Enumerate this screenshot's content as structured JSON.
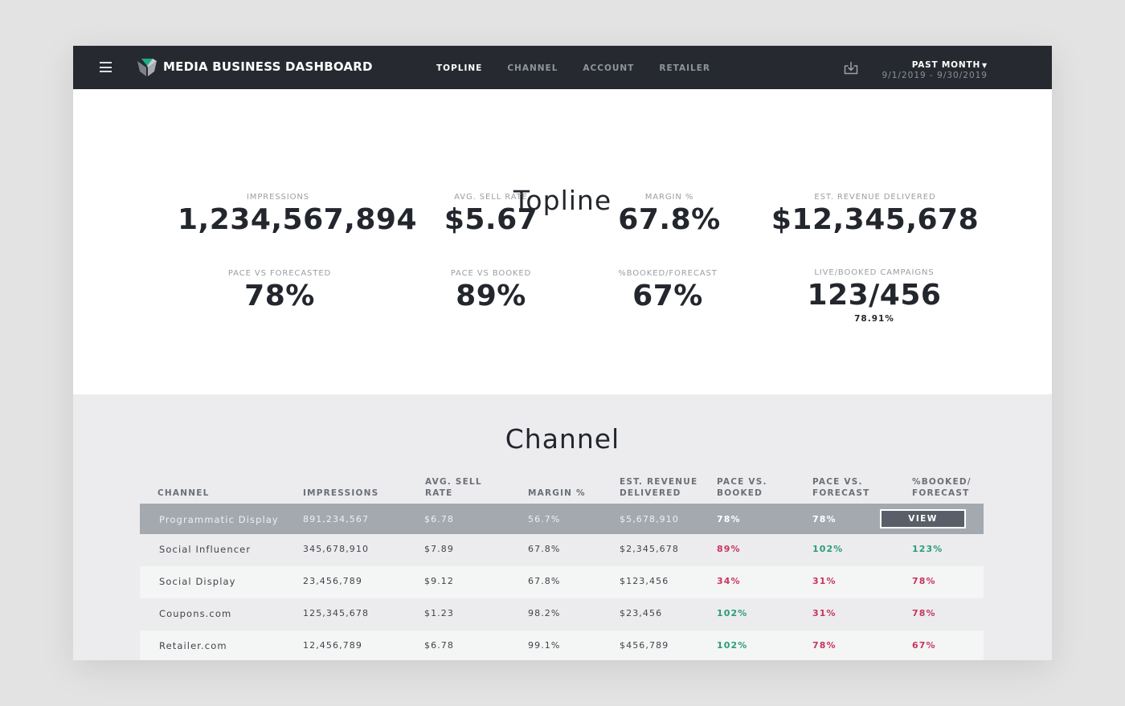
{
  "header": {
    "menu_icon": "hamburger-menu-icon",
    "logo_icon": "brand-logo-icon",
    "app_title": "MEDIA BUSINESS DASHBOARD",
    "nav": [
      {
        "label": "TOPLINE",
        "active": true
      },
      {
        "label": "CHANNEL",
        "active": false
      },
      {
        "label": "ACCOUNT",
        "active": false
      },
      {
        "label": "RETAILER",
        "active": false
      }
    ],
    "download_icon": "download-icon",
    "period": {
      "label": "PAST MONTH",
      "chevron": "⌄",
      "range": "9/1/2019 - 9/30/2019"
    }
  },
  "topline": {
    "title": "Topline",
    "kpis": [
      {
        "label": "IMPRESSIONS",
        "value": "1,234,567,894"
      },
      {
        "label": "AVG. SELL RATE",
        "value": "$5.67"
      },
      {
        "label": "MARGIN %",
        "value": "67.8%"
      },
      {
        "label": "EST. REVENUE DELIVERED",
        "value": "$12,345,678"
      },
      {
        "label": "PACE VS FORECASTED",
        "value": "78%"
      },
      {
        "label": "PACE VS BOOKED",
        "value": "89%"
      },
      {
        "label": "%BOOKED/FORECAST",
        "value": "67%"
      },
      {
        "label": "LIVE/BOOKED CAMPAIGNS",
        "value": "123/456",
        "sub": "78.91%"
      }
    ]
  },
  "channel": {
    "title": "Channel",
    "columns": [
      [
        "CHANNEL"
      ],
      [
        "IMPRESSIONS"
      ],
      [
        "AVG. SELL",
        "RATE"
      ],
      [
        "MARGIN %"
      ],
      [
        "EST. REVENUE",
        "DELIVERED"
      ],
      [
        "PACE VS.",
        "BOOKED"
      ],
      [
        "PACE VS.",
        "FORECAST"
      ],
      [
        "%BOOKED/",
        "FORECAST"
      ]
    ],
    "view_label": "VIEW",
    "colors": {
      "good": "#2a9d78",
      "bad": "#c9345f",
      "selected_row": "#a4a9af"
    },
    "rows": [
      {
        "channel": "Programmatic Display",
        "impressions": "891,234,567",
        "sell_rate": "$6.78",
        "margin": "56.7%",
        "revenue": "$5,678,910",
        "pace_booked": "78%",
        "pace_forecast": "78%",
        "booked_forecast": "",
        "selected": true,
        "status": [
          "",
          "",
          ""
        ]
      },
      {
        "channel": "Social Influencer",
        "impressions": "345,678,910",
        "sell_rate": "$7.89",
        "margin": "67.8%",
        "revenue": "$2,345,678",
        "pace_booked": "89%",
        "pace_forecast": "102%",
        "booked_forecast": "123%",
        "selected": false,
        "status": [
          "bad",
          "good",
          "good"
        ]
      },
      {
        "channel": "Social Display",
        "impressions": "23,456,789",
        "sell_rate": "$9.12",
        "margin": "67.8%",
        "revenue": "$123,456",
        "pace_booked": "34%",
        "pace_forecast": "31%",
        "booked_forecast": "78%",
        "selected": false,
        "status": [
          "bad",
          "bad",
          "bad"
        ]
      },
      {
        "channel": "Coupons.com",
        "impressions": "125,345,678",
        "sell_rate": "$1.23",
        "margin": "98.2%",
        "revenue": "$23,456",
        "pace_booked": "102%",
        "pace_forecast": "31%",
        "booked_forecast": "78%",
        "selected": false,
        "status": [
          "good",
          "bad",
          "bad"
        ]
      },
      {
        "channel": "Retailer.com",
        "impressions": "12,456,789",
        "sell_rate": "$6.78",
        "margin": "99.1%",
        "revenue": "$456,789",
        "pace_booked": "102%",
        "pace_forecast": "78%",
        "booked_forecast": "67%",
        "selected": false,
        "status": [
          "good",
          "bad",
          "bad"
        ]
      }
    ]
  }
}
